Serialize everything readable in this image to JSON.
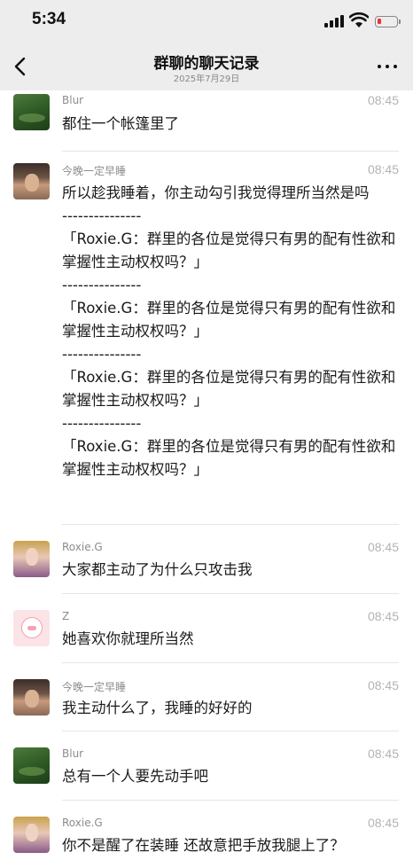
{
  "status_bar": {
    "time": "5:34"
  },
  "header": {
    "title": "群聊的聊天记录",
    "subtitle": "2025年7月29日",
    "back_icon": "chevron-left-icon",
    "more_icon": "more-dots-icon"
  },
  "messages": [
    {
      "sender": "Blur",
      "time": "08:45",
      "avatar": "green-field",
      "text": "都住一个帐篷里了"
    },
    {
      "sender": "今晚一定早睡",
      "time": "08:45",
      "avatar": "man-face",
      "text": "所以趁我睡着，你主动勾引我觉得理所当然是吗\n---------------\n「Roxie.G：群里的各位是觉得只有男的配有性欲和掌握性主动权权吗？」\n---------------\n「Roxie.G：群里的各位是觉得只有男的配有性欲和掌握性主动权权吗？」\n---------------\n「Roxie.G：群里的各位是觉得只有男的配有性欲和掌握性主动权权吗？」\n---------------\n「Roxie.G：群里的各位是觉得只有男的配有性欲和掌握性主动权权吗？」"
    },
    {
      "sender": "Roxie.G",
      "time": "08:45",
      "avatar": "woman-portrait",
      "text": "大家都主动了为什么只攻击我"
    },
    {
      "sender": "Z",
      "time": "08:45",
      "avatar": "bunny-cartoon",
      "text": "她喜欢你就理所当然"
    },
    {
      "sender": "今晚一定早睡",
      "time": "08:45",
      "avatar": "man-face",
      "text": "我主动什么了，我睡的好好的"
    },
    {
      "sender": "Blur",
      "time": "08:45",
      "avatar": "green-field",
      "text": "总有一个人要先动手吧"
    },
    {
      "sender": "Roxie.G",
      "time": "08:45",
      "avatar": "woman-portrait",
      "text": "你不是醒了在装睡 还故意把手放我腿上了？\n---------------"
    }
  ]
}
